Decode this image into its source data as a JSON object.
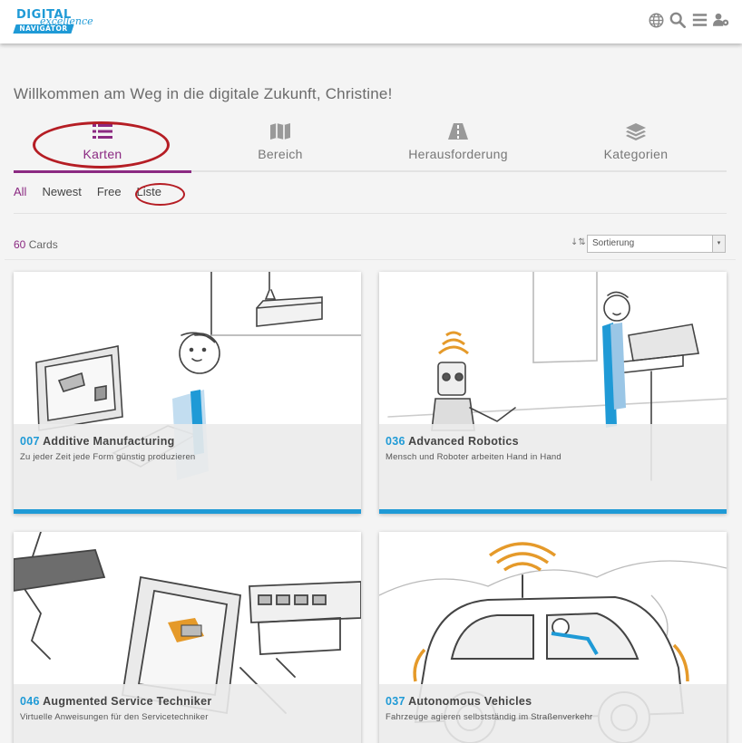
{
  "header": {
    "logo": {
      "line1": "DIGITAL",
      "line2": "excellence",
      "line3": "NAVIGATOR"
    },
    "icons": [
      "globe-icon",
      "search-icon",
      "menu-icon",
      "user-settings-icon"
    ]
  },
  "welcome": "Willkommen am Weg in die digitale Zukunft, Christine!",
  "tabs": [
    {
      "label": "Karten",
      "icon": "list-icon",
      "active": true
    },
    {
      "label": "Bereich",
      "icon": "map-icon"
    },
    {
      "label": "Herausforderung",
      "icon": "road-icon"
    },
    {
      "label": "Kategorien",
      "icon": "layers-icon"
    }
  ],
  "filters": {
    "all": "All",
    "newest": "Newest",
    "free": "Free",
    "liste": "Liste"
  },
  "count": {
    "number": "60",
    "label": "Cards"
  },
  "sort": {
    "value": "Sortierung"
  },
  "cards": [
    {
      "num": "007",
      "title": "Additive Manufacturing",
      "subtitle": "Zu jeder Zeit jede Form günstig produzieren"
    },
    {
      "num": "036",
      "title": "Advanced Robotics",
      "subtitle": "Mensch und Roboter arbeiten Hand in Hand"
    },
    {
      "num": "046",
      "title": "Augmented Service Techniker",
      "subtitle": "Virtuelle Anweisungen für den Servicetechniker"
    },
    {
      "num": "037",
      "title": "Autonomous Vehicles",
      "subtitle": "Fahrzeuge agieren selbstständig im Straßenverkehr"
    }
  ],
  "colors": {
    "accent": "#8b2a82",
    "blue": "#1f9ad6",
    "annotation": "#b51d24"
  }
}
